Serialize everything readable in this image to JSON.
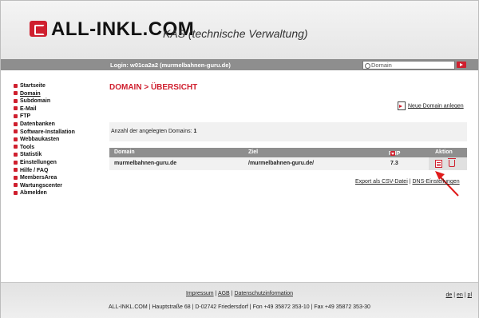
{
  "header": {
    "logo_text": "ALL-INKL.COM",
    "subtitle": "KAS (technische Verwaltung)"
  },
  "topbar": {
    "login": "Login: w01ca2a2 (murmelbahnen-guru.de)",
    "search_placeholder": "Domain"
  },
  "sidebar": {
    "items": [
      {
        "label": "Startseite"
      },
      {
        "label": "Domain"
      },
      {
        "label": "Subdomain"
      },
      {
        "label": "E-Mail"
      },
      {
        "label": "FTP"
      },
      {
        "label": "Datenbanken"
      },
      {
        "label": "Software-Installation"
      },
      {
        "label": "Webbaukasten"
      },
      {
        "label": "Tools"
      },
      {
        "label": "Statistik"
      },
      {
        "label": "Einstellungen"
      },
      {
        "label": "Hilfe / FAQ"
      },
      {
        "label": "MembersArea"
      },
      {
        "label": "Wartungscenter"
      },
      {
        "label": "Abmelden"
      }
    ]
  },
  "main": {
    "title": "DOMAIN > ÜBERSICHT",
    "new_domain_label": "Neue Domain anlegen",
    "count_label": "Anzahl der angelegten Domains:",
    "count_value": "1",
    "table": {
      "headers": {
        "domain": "Domain",
        "ziel": "Ziel",
        "php": "PHP",
        "aktion": "Aktion"
      },
      "rows": [
        {
          "domain": "murmelbahnen-guru.de",
          "ziel": "/murmelbahnen-guru.de/",
          "php": "7.3"
        }
      ]
    },
    "export_label": "Export als CSV-Datei",
    "separator": "|",
    "dns_label": "DNS-Einstellungen"
  },
  "footer": {
    "impressum": "Impressum",
    "agb": "AGB",
    "datenschutz": "Datenschutzinformation",
    "address": "ALL-INKL.COM | Hauptstraße 68 | D-02742 Friedersdorf | Fon +49 35872 353-10 | Fax +49 35872 353-30",
    "lang_de": "de",
    "lang_en": "en",
    "lang_pl": "pl"
  },
  "colors": {
    "accent": "#cf1f2e",
    "bar": "#8e8e8e"
  }
}
